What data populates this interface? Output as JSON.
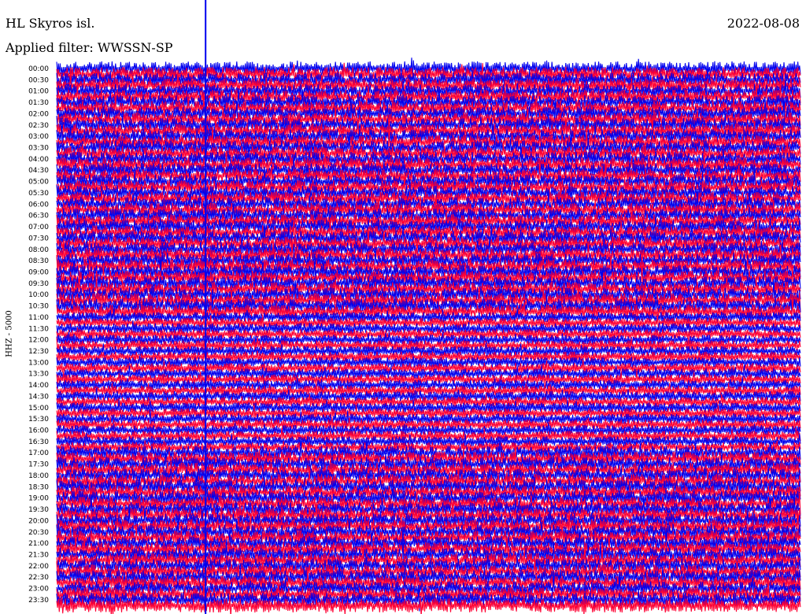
{
  "header": {
    "station": "HL Skyros isl.",
    "filter": "Applied filter: WWSSN-SP",
    "date": "2022-08-08"
  },
  "axis": {
    "channel_label": "HHZ - 5000"
  },
  "colors": {
    "trace_a": "#ff0033",
    "trace_b": "#0000ee",
    "marker": "#0000ee",
    "background": "#ffffff"
  },
  "chart_data": {
    "type": "line",
    "title": "HL Skyros isl.",
    "subtitle": "Applied filter: WWSSN-SP",
    "ylabel": "HHZ - 5000",
    "row_interval_minutes": 15,
    "row_labels": [
      "00:00",
      "00:30",
      "01:00",
      "01:30",
      "02:00",
      "02:30",
      "03:00",
      "03:30",
      "04:00",
      "04:30",
      "05:00",
      "05:30",
      "06:00",
      "06:30",
      "07:00",
      "07:30",
      "08:00",
      "08:30",
      "09:00",
      "09:30",
      "10:00",
      "10:30",
      "11:00",
      "11:30",
      "12:00",
      "12:30",
      "13:00",
      "13:30",
      "14:00",
      "14:30",
      "15:00",
      "15:30",
      "16:00",
      "16:30",
      "17:00",
      "17:30",
      "18:00",
      "18:30",
      "19:00",
      "19:30",
      "20:00",
      "20:30",
      "21:00",
      "21:30",
      "22:00",
      "22:30",
      "23:00",
      "23:30"
    ],
    "row_count": 96,
    "current_time_marker_fraction": 0.2
  }
}
